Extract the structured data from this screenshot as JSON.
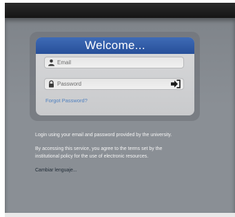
{
  "header": {
    "title": "Welcome..."
  },
  "login": {
    "email_placeholder": "Email",
    "password_placeholder": "Password",
    "forgot_link": "Forgot Password?"
  },
  "info": {
    "line1": "Login using your email and password provided by the university.",
    "line2": "By accessing this service, you agree to the terms set by the institutional policy for the use of electronic resources."
  },
  "language_link": "Cambiar lenguaje...",
  "icons": {
    "email": "user-icon",
    "password": "lock-icon",
    "submit": "sign-in-arrow-icon"
  },
  "colors": {
    "header_blue": "#2f5ba8",
    "link_blue": "#4d7fbf",
    "background_gray": "#8a8f95",
    "top_bar": "#1c1c1c"
  }
}
